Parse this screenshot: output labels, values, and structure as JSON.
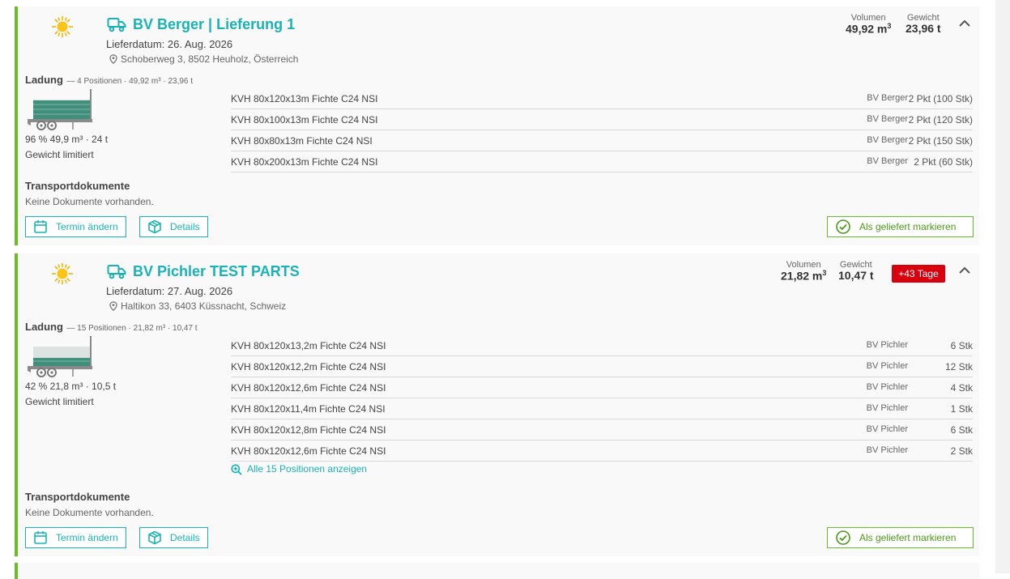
{
  "deliveries": [
    {
      "title": "BV Berger | Lieferung 1",
      "date": "Lieferdatum: 26. Aug. 2026",
      "address": "Schoberweg 3, 8502 Heuholz, Österreich",
      "volume_label": "Volumen",
      "volume_value": "49,92 m",
      "volume_exp": "3",
      "weight_label": "Gewicht",
      "weight_value": "23,96 t",
      "ladung_title": "Ladung",
      "ladung_sub": "— 4 Positionen · 49,92 m³ · 23,96 t",
      "load_pct": "96 % 49,9 m³ · 24 t",
      "load_fraction": 0.96,
      "load_note": "Gewicht limitiert",
      "items": [
        {
          "name": "KVH 80x120x13m Fichte C24 NSI",
          "supplier": "BV Berger",
          "qty": "2 Pkt (100 Stk)"
        },
        {
          "name": "KVH 80x100x13m Fichte C24 NSI",
          "supplier": "BV Berger",
          "qty": "2 Pkt (120 Stk)"
        },
        {
          "name": "KVH 80x80x13m Fichte C24 NSI",
          "supplier": "BV Berger",
          "qty": "2 Pkt (150 Stk)"
        },
        {
          "name": "KVH 80x200x13m Fichte C24 NSI",
          "supplier": "BV Berger",
          "qty": "2 Pkt (60 Stk)"
        }
      ],
      "docs_title": "Transportdokumente",
      "docs_text": "Keine Dokumente vorhanden.",
      "btn_termin": "Termin ändern",
      "btn_details": "Details",
      "btn_delivered": "Als geliefert markieren"
    },
    {
      "title": "BV Pichler TEST PARTS",
      "date": "Lieferdatum: 27. Aug. 2026",
      "address": "Haltikon 33, 6403 Küssnacht, Schweiz",
      "volume_label": "Volumen",
      "volume_value": "21,82 m",
      "volume_exp": "3",
      "weight_label": "Gewicht",
      "weight_value": "10,47 t",
      "badge": "+43 Tage",
      "ladung_title": "Ladung",
      "ladung_sub": "— 15 Positionen · 21,82 m³ · 10,47 t",
      "load_pct": "42 % 21,8 m³ · 10,5 t",
      "load_fraction": 0.42,
      "load_note": "Gewicht limitiert",
      "items": [
        {
          "name": "KVH 80x120x13,2m Fichte C24 NSI",
          "supplier": "BV Pichler",
          "qty": "6 Stk"
        },
        {
          "name": "KVH 80x120x12,2m Fichte C24 NSI",
          "supplier": "BV Pichler",
          "qty": "12 Stk"
        },
        {
          "name": "KVH 80x120x12,6m Fichte C24 NSI",
          "supplier": "BV Pichler",
          "qty": "4 Stk"
        },
        {
          "name": "KVH 80x120x11,4m Fichte C24 NSI",
          "supplier": "BV Pichler",
          "qty": "1 Stk"
        },
        {
          "name": "KVH 80x120x12,8m Fichte C24 NSI",
          "supplier": "BV Pichler",
          "qty": "6 Stk"
        },
        {
          "name": "KVH 80x120x12,6m Fichte C24 NSI",
          "supplier": "BV Pichler",
          "qty": "2 Stk"
        }
      ],
      "show_all": "Alle 15 Positionen anzeigen",
      "docs_title": "Transportdokumente",
      "docs_text": "Keine Dokumente vorhanden.",
      "btn_termin": "Termin ändern",
      "btn_details": "Details",
      "btn_delivered": "Als geliefert markieren"
    }
  ],
  "colors": {
    "accent": "#1ab3b3",
    "status_green": "#6cbb2a",
    "badge_red": "#d9000d",
    "card_bg": "#f9f9f9"
  },
  "icons": [
    "sun-icon",
    "truck-icon",
    "location-pin-icon",
    "chevron-up-icon",
    "trailer-icon",
    "calendar-icon",
    "box-icon",
    "zoom-in-icon",
    "check-circle-icon"
  ]
}
